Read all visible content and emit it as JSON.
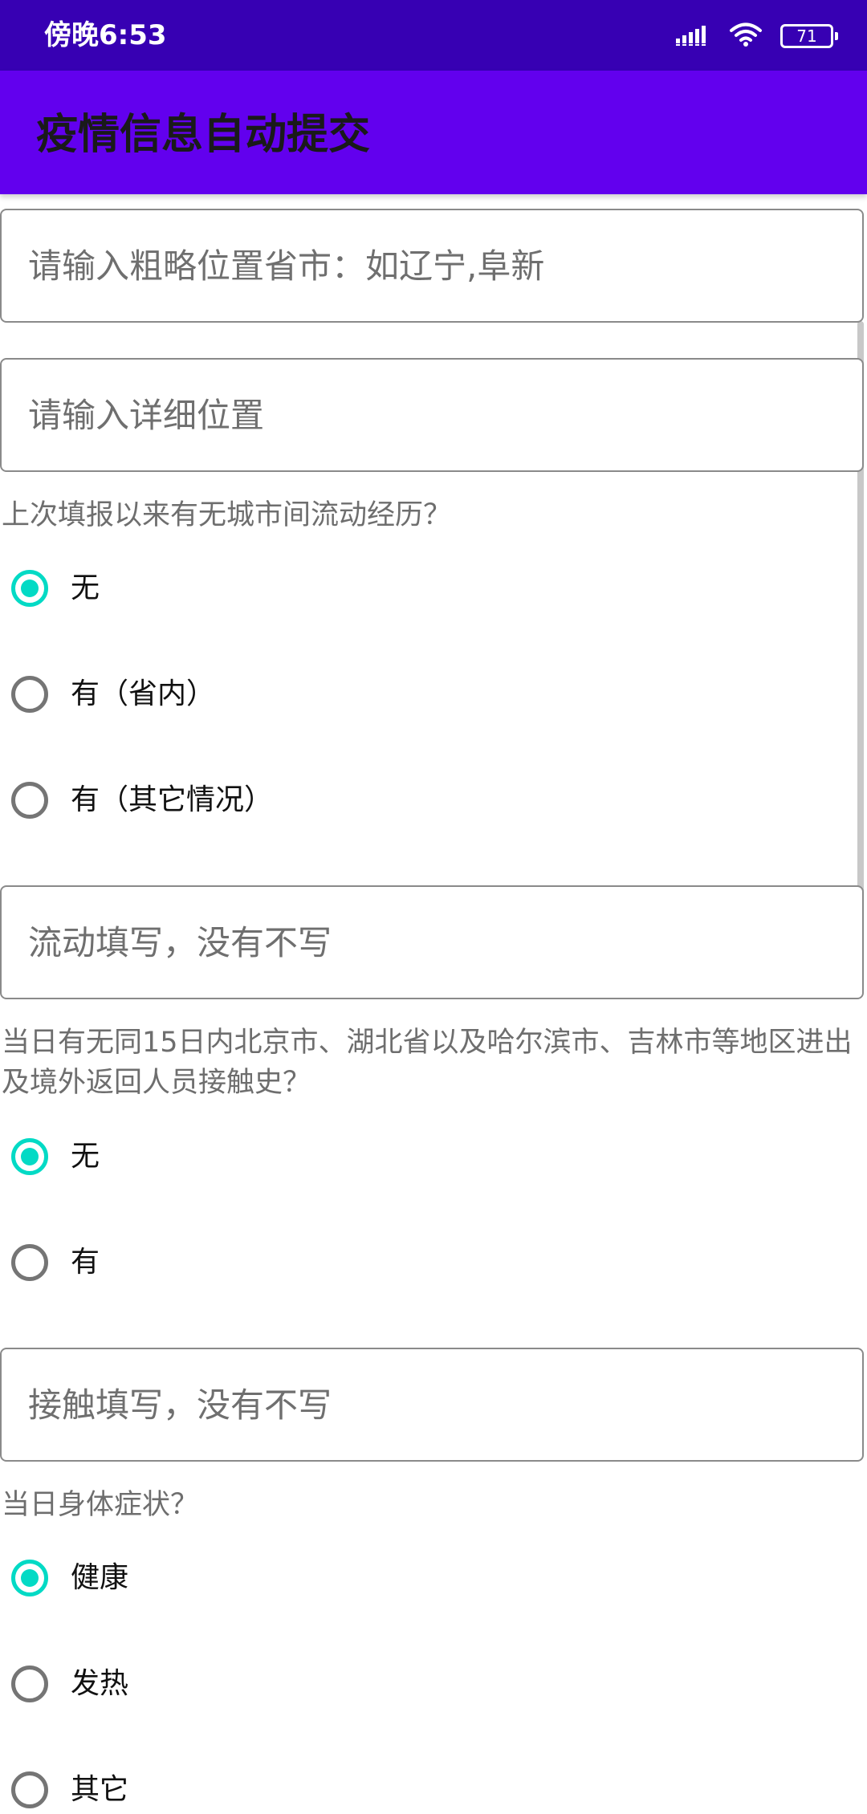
{
  "status_bar": {
    "time": "傍晚6:53",
    "battery_level": "71",
    "background_color": "#3700b3",
    "icons": [
      "signal-icon",
      "wifi-icon",
      "battery-icon"
    ]
  },
  "app_bar": {
    "title": "疫情信息自动提交",
    "background_color": "#6200ee"
  },
  "form": {
    "location_rough": {
      "placeholder": "请输入粗略位置省市：如辽宁,阜新",
      "value": ""
    },
    "location_detail": {
      "placeholder": "请输入详细位置",
      "value": ""
    },
    "travel_question": "上次填报以来有无城市间流动经历？",
    "travel_options": [
      {
        "label": "无",
        "checked": true
      },
      {
        "label": "有（省内）",
        "checked": false
      },
      {
        "label": "有（其它情况）",
        "checked": false
      }
    ],
    "travel_detail": {
      "placeholder": "流动填写，没有不写",
      "value": ""
    },
    "contact_question": "当日有无同15日内北京市、湖北省以及哈尔滨市、吉林市等地区进出及境外返回人员接触史？",
    "contact_options": [
      {
        "label": "无",
        "checked": true
      },
      {
        "label": "有",
        "checked": false
      }
    ],
    "contact_detail": {
      "placeholder": "接触填写，没有不写",
      "value": ""
    },
    "health_question": "当日身体症状？",
    "health_options": [
      {
        "label": "健康",
        "checked": true
      },
      {
        "label": "发热",
        "checked": false
      },
      {
        "label": "其它",
        "checked": false
      }
    ]
  },
  "colors": {
    "accent": "#03dac5",
    "radio_unchecked": "#757575",
    "field_border": "#8a8a8a"
  }
}
